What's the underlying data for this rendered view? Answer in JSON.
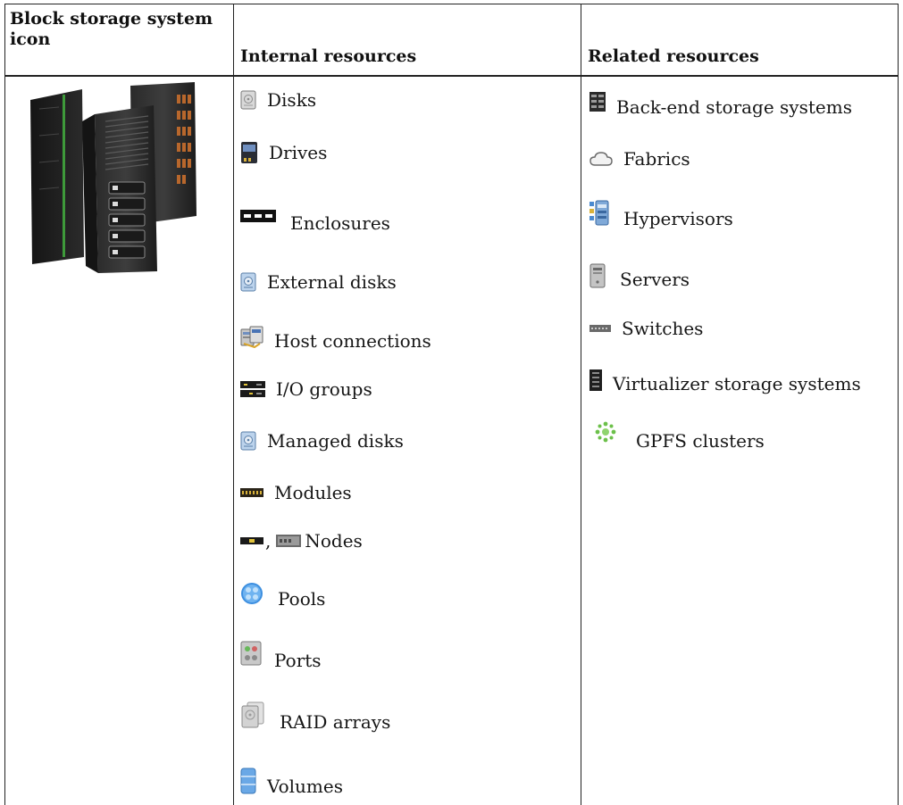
{
  "headers": {
    "col1": "Block storage system icon",
    "col2": "Internal resources",
    "col3": "Related resources"
  },
  "internal_resources": [
    {
      "label": "Disks",
      "icon": "disk-icon"
    },
    {
      "label": "Drives",
      "icon": "drive-icon"
    },
    {
      "label": "Enclosures",
      "icon": "enclosure-icon"
    },
    {
      "label": "External disks",
      "icon": "external-disk-icon"
    },
    {
      "label": "Host connections",
      "icon": "host-connection-icon"
    },
    {
      "label": "I/O groups",
      "icon": "io-group-icon"
    },
    {
      "label": "Managed disks",
      "icon": "managed-disk-icon"
    },
    {
      "label": "Modules",
      "icon": "module-icon"
    },
    {
      "label": "Nodes",
      "icon": "node-icon"
    },
    {
      "label": "Pools",
      "icon": "pool-icon"
    },
    {
      "label": "Ports",
      "icon": "port-icon"
    },
    {
      "label": "RAID arrays",
      "icon": "raid-array-icon"
    },
    {
      "label": "Volumes",
      "icon": "volume-icon"
    }
  ],
  "related_resources": [
    {
      "label": "Back-end storage systems",
      "icon": "backend-storage-icon"
    },
    {
      "label": "Fabrics",
      "icon": "fabric-cloud-icon"
    },
    {
      "label": "Hypervisors",
      "icon": "hypervisor-icon"
    },
    {
      "label": "Servers",
      "icon": "server-icon"
    },
    {
      "label": "Switches",
      "icon": "switch-icon"
    },
    {
      "label": "Virtualizer storage systems",
      "icon": "virtualizer-storage-icon"
    },
    {
      "label": "GPFS clusters",
      "icon": "gpfs-cluster-icon"
    }
  ],
  "nodes_separator": ",",
  "colors": {
    "border": "#222222",
    "text": "#111111"
  }
}
